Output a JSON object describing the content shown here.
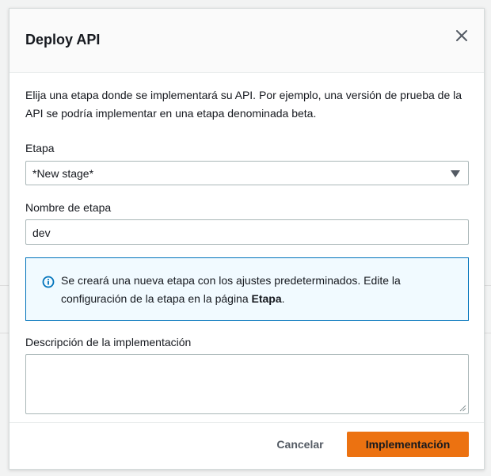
{
  "modal": {
    "title": "Deploy API",
    "intro": "Elija una etapa donde se implementará su API. Por ejemplo, una versión de prueba de la API se podría implementar en una etapa denominada beta."
  },
  "stage_field": {
    "label": "Etapa",
    "selected": "*New stage*"
  },
  "stage_name_field": {
    "label": "Nombre de etapa",
    "value": "dev"
  },
  "info_alert": {
    "text_before": "Se creará una nueva etapa con los ajustes predeterminados. Edite la configuración de la etapa en la página ",
    "link_text": "Etapa",
    "text_after": "."
  },
  "description_field": {
    "label": "Descripción de la implementación",
    "value": ""
  },
  "footer": {
    "cancel_label": "Cancelar",
    "deploy_label": "Implementación"
  },
  "colors": {
    "primary_button": "#ec7211",
    "info_border": "#0073bb",
    "info_background": "#f1faff"
  },
  "icons": {
    "close": "close-icon",
    "caret": "caret-down-icon",
    "info": "info-icon",
    "resize": "resize-grip-icon"
  }
}
